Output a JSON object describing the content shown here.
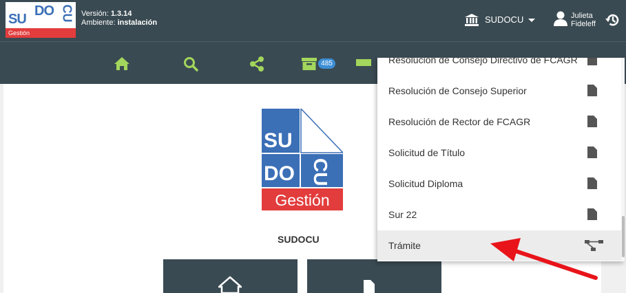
{
  "header": {
    "logo": {
      "line1": "SU",
      "line2": "DO",
      "line3": "CU",
      "sub": "Gestión"
    },
    "version_label": "Versión:",
    "version_value": "1.3.14",
    "env_label": "Ambiente:",
    "env_value": "instalación",
    "institution": "SUDOCU",
    "institution_icon": "institution-icon",
    "user_first": "Julieta",
    "user_last": "Fideleff",
    "user_icon": "user-icon",
    "history_icon": "history-icon"
  },
  "toolbar": {
    "items": [
      "home-icon",
      "search-icon",
      "share-icon",
      "archive-icon"
    ],
    "archive_count": "485",
    "accent": "#a3d65c"
  },
  "dropdown": {
    "partial_item": "Resolución de Consejo Directivo de FCAGR",
    "items": [
      {
        "label": "Resolución de Consejo Superior",
        "icon": "file-icon"
      },
      {
        "label": "Resolución de Rector de FCAGR",
        "icon": "file-icon"
      },
      {
        "label": "Solicitud de Título",
        "icon": "file-icon"
      },
      {
        "label": "Solicitud Diploma",
        "icon": "file-icon"
      },
      {
        "label": "Sur 22",
        "icon": "file-icon"
      },
      {
        "label": "Trámite",
        "icon": "flow-icon"
      }
    ]
  },
  "main": {
    "logo": {
      "su": "SU",
      "do": "DO",
      "cu": "CU",
      "sub": "Gestión"
    },
    "site_name": "SUDOCU",
    "cards": [
      "home-icon",
      "document-icon"
    ]
  },
  "colors": {
    "header_bg": "#3a4a52",
    "brand_blue": "#3b6fb6",
    "brand_red": "#e23c3c",
    "annotation_arrow": "#e8141a"
  }
}
